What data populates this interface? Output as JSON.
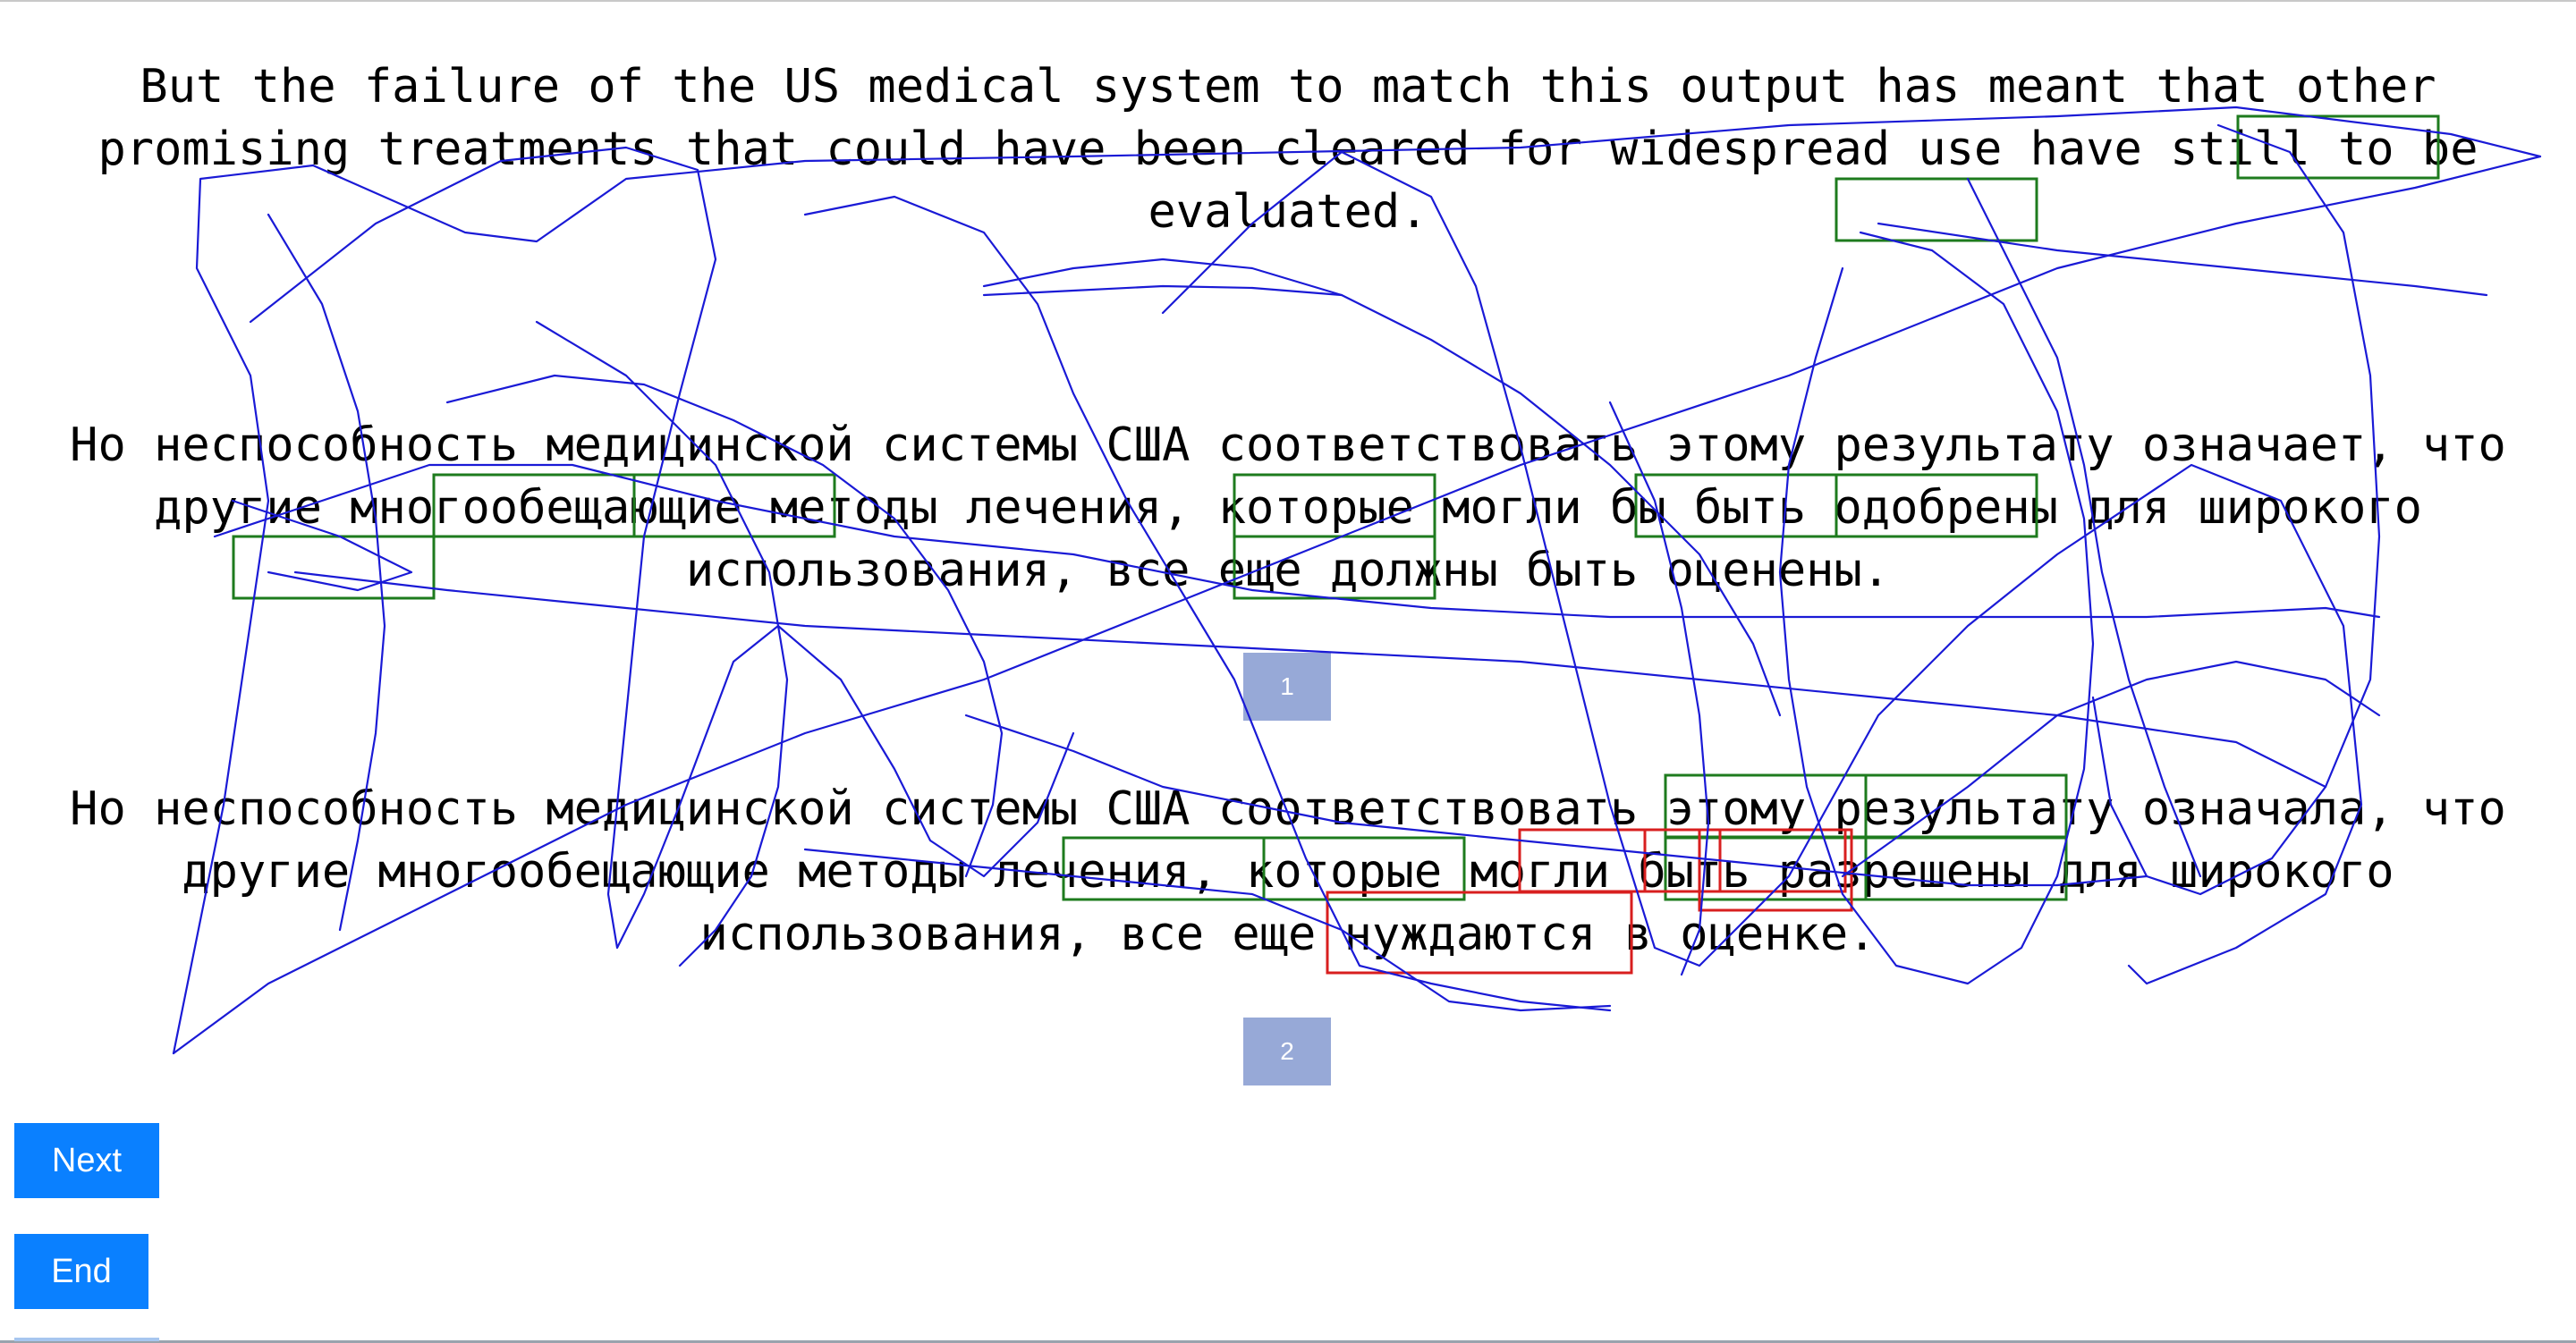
{
  "source_sentence": "But the failure of the US medical system to match this output has meant that other promising treatments that could have been cleared for widespread use have still to be evaluated.",
  "reference_translation": "Но неспособность медицинской системы США соответствовать этому результату означает, что другие многообещающие методы лечения, которые могли бы быть одобрены для широкого использования, все еще должны быть оценены.",
  "candidate_translation": "Но неспособность медицинской системы США соответствовать этому результату означала, что другие многообещающие методы лечения, которые могли быть разрешены для широкого использования, все еще нуждаются в оценке.",
  "labels": {
    "first": "1",
    "second": "2"
  },
  "buttons": {
    "next": "Next",
    "end": "End"
  },
  "colors": {
    "match_box": "#1e7b1e",
    "mismatch_box": "#d81f1f",
    "scribble": "#1a1ad6",
    "label_bg": "#97a9d7",
    "button_bg": "#0a80ff"
  }
}
